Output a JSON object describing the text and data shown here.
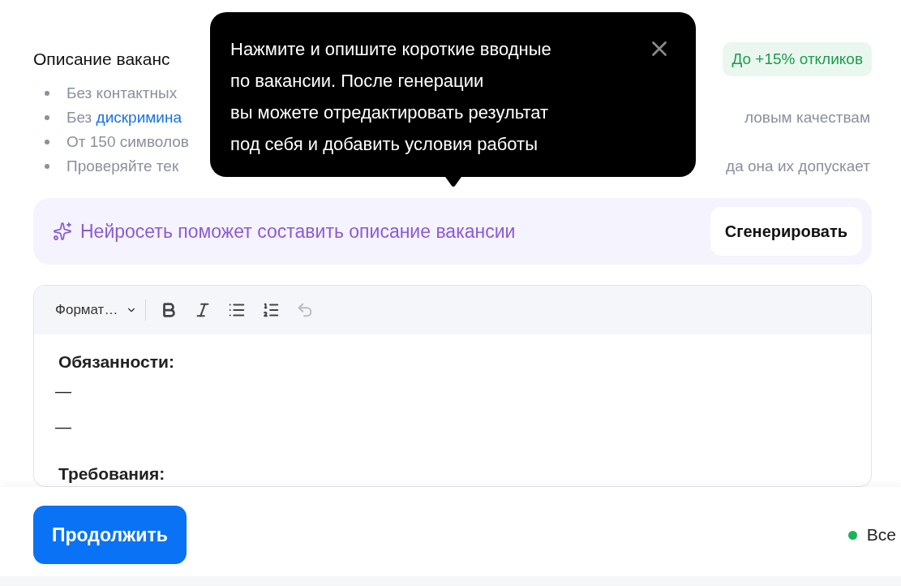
{
  "section": {
    "title": "Описание ваканс",
    "badge": "До +15% откликов"
  },
  "rules": [
    {
      "left": "Без контактных"
    },
    {
      "left": "Без ",
      "link": "дискримина",
      "right": "ловым качествам"
    },
    {
      "left": "От 150 символов"
    },
    {
      "left": "Проверяйте тек",
      "right": "да она их допускает"
    }
  ],
  "tooltip": {
    "text": "Нажмите и опишите короткие вводные\nпо вакансии. После генерации\nвы можете отредактировать результат\nпод себя и добавить условия работы"
  },
  "ai_banner": {
    "text": "Нейросеть поможет составить описание вакансии",
    "button": "Сгенерировать"
  },
  "editor": {
    "format_select": "Формат…",
    "toolbar": [
      {
        "kind": "bold",
        "disabled": false
      },
      {
        "kind": "italic",
        "disabled": false
      },
      {
        "kind": "bullets",
        "disabled": false
      },
      {
        "kind": "numbers",
        "disabled": false
      },
      {
        "kind": "undo",
        "disabled": true
      }
    ],
    "content": [
      {
        "kind": "heading",
        "text": "Обязанности:"
      },
      {
        "kind": "dash",
        "text": "—"
      },
      {
        "kind": "dash",
        "text": "—"
      },
      {
        "kind": "heading",
        "text": "Требования:"
      }
    ]
  },
  "footer": {
    "button": "Продолжить",
    "status": "Все"
  }
}
